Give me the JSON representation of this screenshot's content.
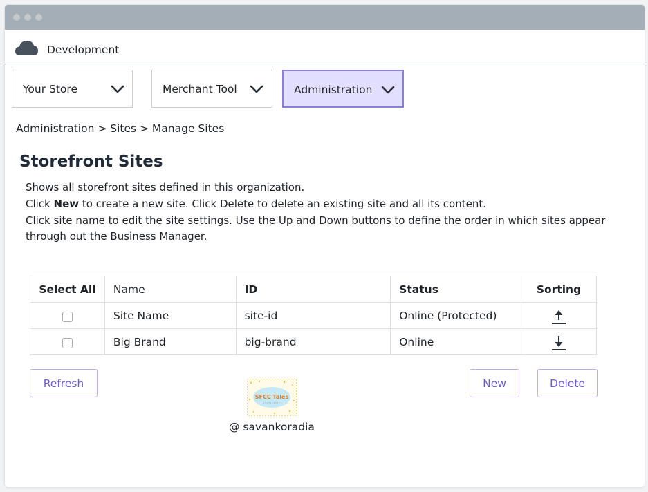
{
  "app": {
    "title": "Development"
  },
  "nav": {
    "items": [
      {
        "label": "Your Store",
        "active": false
      },
      {
        "label": "Merchant Tool",
        "active": false
      },
      {
        "label": "Administration",
        "active": true
      }
    ]
  },
  "breadcrumb": "Administration > Sites > Manage Sites",
  "page": {
    "title": "Storefront Sites",
    "desc_line1": "Shows all storefront sites defined in this organization.",
    "desc_line2_pre": "Click ",
    "desc_line2_bold": "New",
    "desc_line2_post": " to create a new site. Click Delete to delete an existing site and all its content.",
    "desc_line3": "Click site name to edit the site settings. Use the Up and Down buttons to define the order in which sites appear through out the Business Manager."
  },
  "table": {
    "headers": {
      "select": "Select All",
      "name": "Name",
      "id": "ID",
      "status": "Status",
      "sorting": "Sorting"
    },
    "rows": [
      {
        "name": "Site Name",
        "id": "site-id",
        "status": "Online (Protected)",
        "sort_icon": "arrow-up-icon"
      },
      {
        "name": "Big Brand",
        "id": "big-brand",
        "status": "Online",
        "sort_icon": "arrow-down-icon"
      }
    ]
  },
  "buttons": {
    "refresh": "Refresh",
    "new": "New",
    "delete": "Delete"
  },
  "logo": {
    "text": "SFCC Tales"
  },
  "credit": "@ savankoradia",
  "colors": {
    "titlebar": "#a4aeb7",
    "accent": "#6a5ad0",
    "active_tab_bg": "#e2deff",
    "active_tab_border": "#8a7fde"
  }
}
